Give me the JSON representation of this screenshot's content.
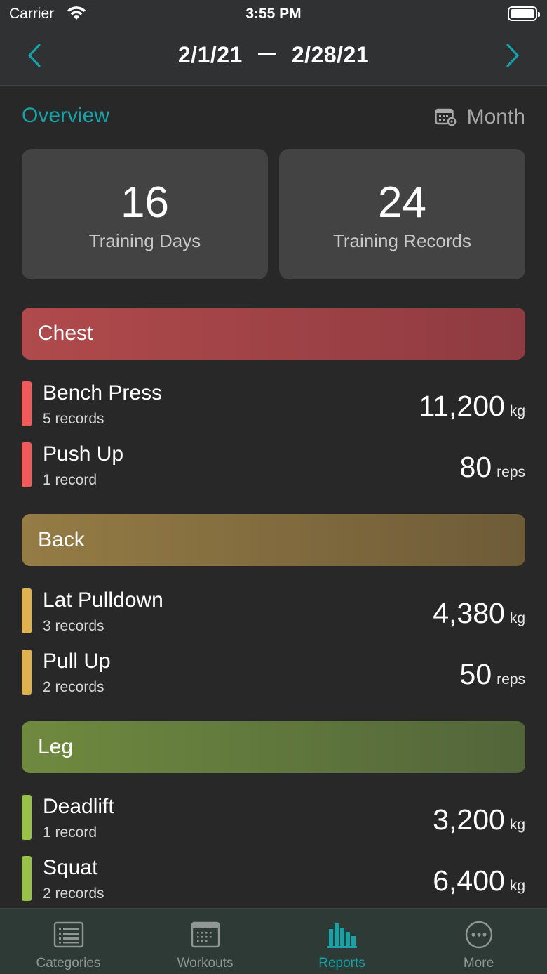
{
  "status_bar": {
    "carrier": "Carrier",
    "time": "3:55 PM"
  },
  "nav": {
    "start_date": "2/1/21",
    "end_date": "2/28/21"
  },
  "overview": {
    "title": "Overview",
    "period_label": "Month",
    "stats": [
      {
        "value": "16",
        "label": "Training Days"
      },
      {
        "value": "24",
        "label": "Training Records"
      }
    ]
  },
  "categories": [
    {
      "name": "Chest",
      "color": "#f05a5a",
      "exercises": [
        {
          "name": "Bench Press",
          "records": "5 records",
          "value": "11,200",
          "unit": "kg"
        },
        {
          "name": "Push Up",
          "records": "1 record",
          "value": "80",
          "unit": "reps"
        }
      ]
    },
    {
      "name": "Back",
      "color": "#e0b24f",
      "exercises": [
        {
          "name": "Lat Pulldown",
          "records": "3 records",
          "value": "4,380",
          "unit": "kg"
        },
        {
          "name": "Pull Up",
          "records": "2 records",
          "value": "50",
          "unit": "reps"
        }
      ]
    },
    {
      "name": "Leg",
      "color": "#98c24a",
      "exercises": [
        {
          "name": "Deadlift",
          "records": "1 record",
          "value": "3,200",
          "unit": "kg"
        },
        {
          "name": "Squat",
          "records": "2 records",
          "value": "6,400",
          "unit": "kg"
        }
      ]
    }
  ],
  "tabs": [
    {
      "label": "Categories",
      "icon": "list-icon",
      "active": false
    },
    {
      "label": "Workouts",
      "icon": "calendar-icon",
      "active": false
    },
    {
      "label": "Reports",
      "icon": "bar-chart-icon",
      "active": true
    },
    {
      "label": "More",
      "icon": "more-icon",
      "active": false
    }
  ],
  "colors": {
    "accent": "#17a2a8",
    "background": "#282828",
    "card": "#434343"
  }
}
